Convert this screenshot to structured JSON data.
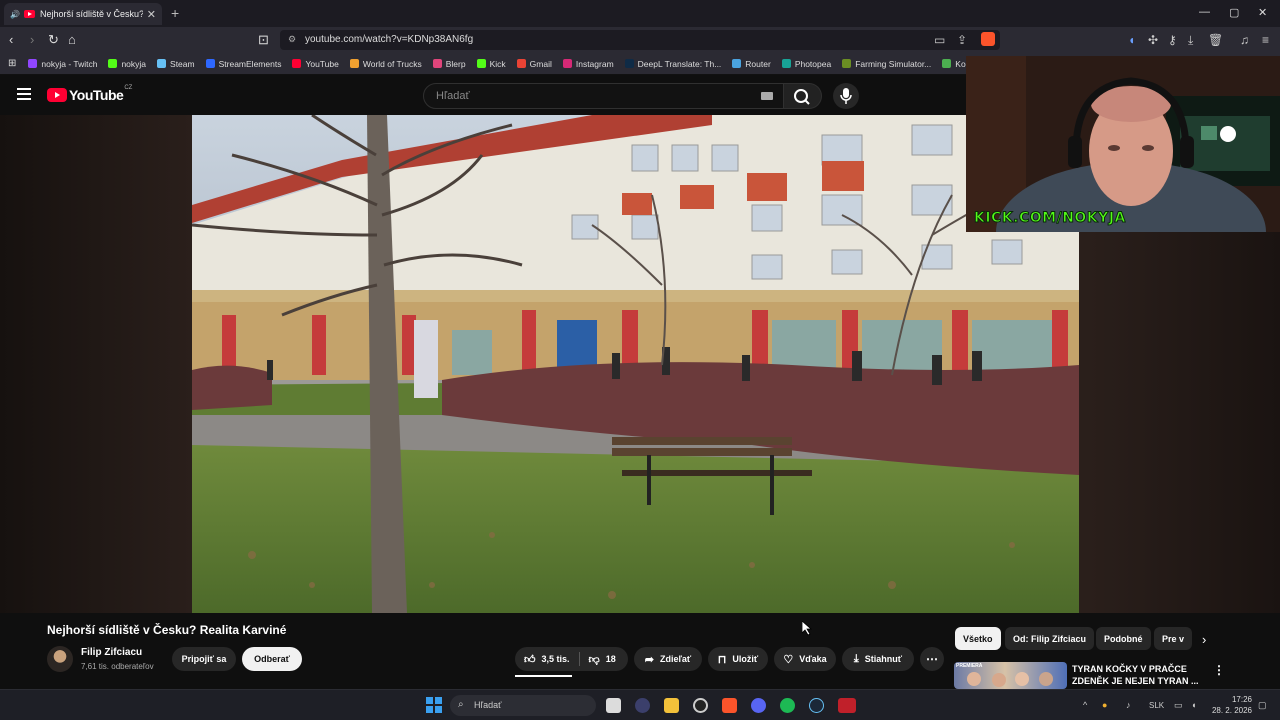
{
  "browser": {
    "tab_title": "Nejhorší sídliště v Česku? Rea",
    "url": "youtube.com/watch?v=KDNp38AN6fg",
    "bookmarks": [
      {
        "label": "nokyja - Twitch",
        "color": "#9146ff"
      },
      {
        "label": "nokyja",
        "color": "#53fc18"
      },
      {
        "label": "Steam",
        "color": "#66c0f4"
      },
      {
        "label": "StreamElements",
        "color": "#2e68ff"
      },
      {
        "label": "YouTube",
        "color": "#ff0033"
      },
      {
        "label": "World of Trucks",
        "color": "#f0a030"
      },
      {
        "label": "Blerp",
        "color": "#e0457b"
      },
      {
        "label": "Kick",
        "color": "#53fc18"
      },
      {
        "label": "Gmail",
        "color": "#ea4335"
      },
      {
        "label": "Instagram",
        "color": "#d62976"
      },
      {
        "label": "DeepL Translate: Th...",
        "color": "#0f2b46"
      },
      {
        "label": "Router",
        "color": "#4aa3df"
      },
      {
        "label": "Photopea",
        "color": "#18a497"
      },
      {
        "label": "Farming Simulator...",
        "color": "#6b8e23"
      },
      {
        "label": "Ko",
        "color": "#4caf50"
      }
    ]
  },
  "youtube": {
    "logo_text": "YouTube",
    "region": "CZ",
    "search_placeholder": "Hľadať"
  },
  "webcam": {
    "overlay_text": "KICK.COM/NOKYJA"
  },
  "video": {
    "title": "Nejhorší sídliště v Česku? Realita Karviné",
    "channel": "Filip Zifciacu",
    "subscribers": "7,61 tis. odberateľov",
    "join_label": "Pripojiť sa",
    "subscribe_label": "Odberať",
    "likes": "3,5 tis.",
    "dislikes": "18",
    "share_label": "Zdieľať",
    "save_label": "Uložiť",
    "thanks_label": "Vďaka",
    "download_label": "Stiahnuť",
    "more_icon": "more-horizontal-icon"
  },
  "recommendations": {
    "chips": [
      "Všetko",
      "Od: Filip Zifciacu",
      "Podobné",
      "Pre v"
    ],
    "first": {
      "thumb_text": "PREMIERA",
      "title_line1": "TYRAN KOČKY V PRAČCE",
      "title_line2": "ZDENĚK JE NEJEN TYRAN ..."
    }
  },
  "taskbar": {
    "search_placeholder": "Hľadať",
    "language": "SLK",
    "time": "17:26",
    "date": "28. 2. 2026"
  }
}
